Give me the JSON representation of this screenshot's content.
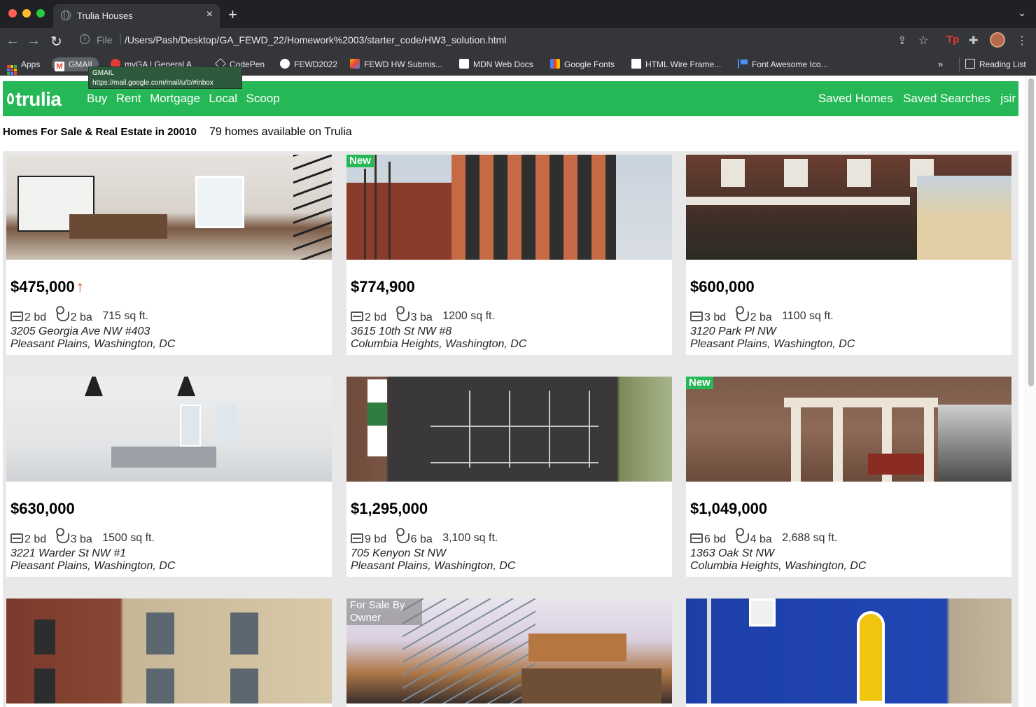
{
  "browser": {
    "tab_title": "Trulia Houses",
    "tab_close": "×",
    "new_tab": "+",
    "tab_menu": "⌄",
    "omnibox_scheme": "File",
    "omnibox_url": "/Users/Pash/Desktop/GA_FEWD_22/Homework%2003/starter_code/HW3_solution.html",
    "nav_back": "←",
    "nav_forward": "→",
    "nav_reload": "↻",
    "share_icon": "⇪",
    "star_icon": "☆",
    "tp_label": "Tp",
    "puzzle_icon": "✚",
    "kebab": "⋮",
    "bookmarks": [
      {
        "label": "Apps",
        "icon": "apps-grid",
        "color": "#ea4335"
      },
      {
        "label": "GMAIL",
        "icon": "gmail",
        "color": "#ea4335"
      },
      {
        "label": "myGA | General A...",
        "icon": "ga",
        "color": "#e53935"
      },
      {
        "label": "CodePen",
        "icon": "codepen",
        "color": "#ffffff"
      },
      {
        "label": "FEWD2022",
        "icon": "github",
        "color": "#ffffff"
      },
      {
        "label": "FEWD HW Submis...",
        "icon": "form",
        "color": "#f4b400"
      },
      {
        "label": "MDN Web Docs",
        "icon": "mdn",
        "color": "#ffffff"
      },
      {
        "label": "Google Fonts",
        "icon": "gfonts",
        "color": "#4285f4"
      },
      {
        "label": "HTML Wire Frame...",
        "icon": "doc",
        "color": "#ffffff"
      },
      {
        "label": "Font Awesome Ico...",
        "icon": "flag",
        "color": "#4d8ff5"
      }
    ],
    "bookmarks_more": "»",
    "reading_list": "Reading List",
    "tooltip_title": "GMAIL",
    "tooltip_url": "https://mail.google.com/mail/u/0/#inbox"
  },
  "site": {
    "logo": "trulia",
    "brand_color": "#26b857",
    "nav_left": [
      "Buy",
      "Rent",
      "Mortgage",
      "Local",
      "Scoop"
    ],
    "nav_right": [
      "Saved Homes",
      "Saved Searches",
      "jsir"
    ]
  },
  "heading": {
    "title": "Homes For Sale & Real Estate in 20010",
    "available": "79 homes available on Trulia"
  },
  "listings": [
    {
      "price": "$475,000",
      "arrow": "↑",
      "beds": "2 bd",
      "baths": "2 ba",
      "sqft": "715 sq ft.",
      "street": "3205 Georgia Ave NW #403",
      "area": "Pleasant Plains, Washington, DC",
      "badge": ""
    },
    {
      "price": "$774,900",
      "arrow": "",
      "beds": "2 bd",
      "baths": "3 ba",
      "sqft": "1200 sq ft.",
      "street": "3615 10th St NW #8",
      "area": "Columbia Heights, Washington, DC",
      "badge": "New"
    },
    {
      "price": "$600,000",
      "arrow": "",
      "beds": "3 bd",
      "baths": "2 ba",
      "sqft": "1100 sq ft.",
      "street": "3120 Park Pl NW",
      "area": "Pleasant Plains, Washington, DC",
      "badge": ""
    },
    {
      "price": "$630,000",
      "arrow": "",
      "beds": "2 bd",
      "baths": "3 ba",
      "sqft": "1500 sq ft.",
      "street": "3221 Warder St NW #1",
      "area": "Pleasant Plains, Washington, DC",
      "badge": ""
    },
    {
      "price": "$1,295,000",
      "arrow": "",
      "beds": "9 bd",
      "baths": "6 ba",
      "sqft": "3,100 sq ft.",
      "street": "705 Kenyon St NW",
      "area": "Pleasant Plains, Washington, DC",
      "badge": ""
    },
    {
      "price": "$1,049,000",
      "arrow": "",
      "beds": "6 bd",
      "baths": "4 ba",
      "sqft": "2,688 sq ft.",
      "street": "1363 Oak St NW",
      "area": "Columbia Heights, Washington, DC",
      "badge": "New"
    },
    {
      "price": "",
      "arrow": "",
      "beds": "",
      "baths": "",
      "sqft": "",
      "street": "",
      "area": "",
      "badge": ""
    },
    {
      "price": "",
      "arrow": "",
      "beds": "",
      "baths": "",
      "sqft": "",
      "street": "",
      "area": "",
      "badge": "For Sale By Owner"
    },
    {
      "price": "",
      "arrow": "",
      "beds": "",
      "baths": "",
      "sqft": "",
      "street": "",
      "area": "",
      "badge": ""
    }
  ]
}
